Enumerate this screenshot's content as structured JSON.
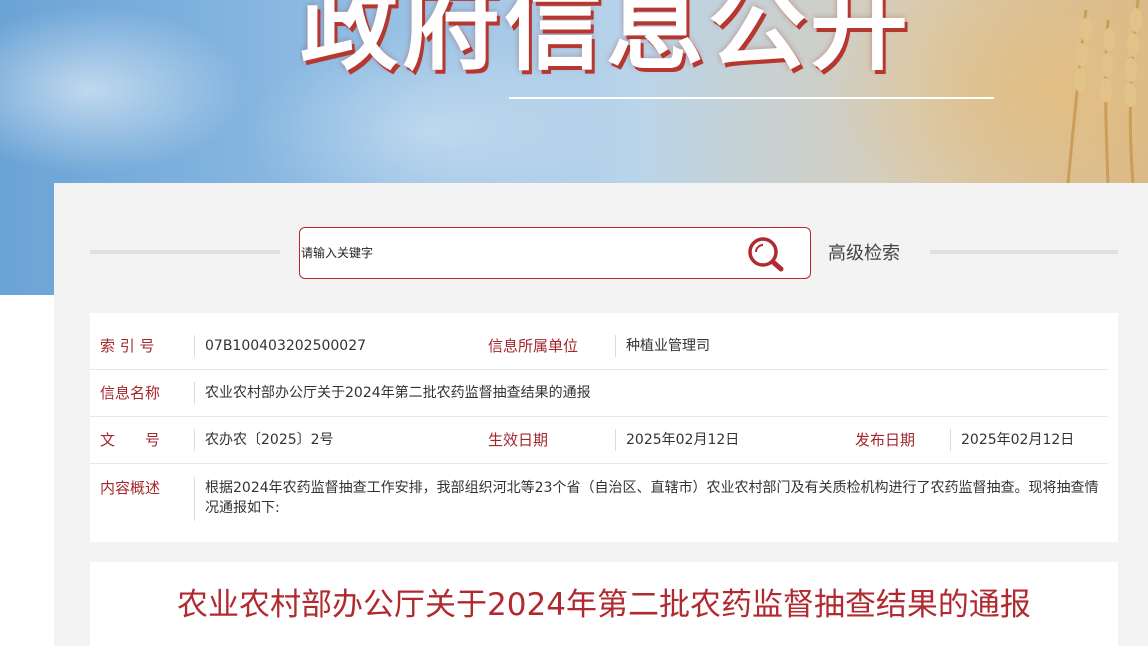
{
  "banner": {
    "title": "政府信息公开"
  },
  "search": {
    "placeholder": "请输入关键字",
    "button_icon": "search-icon",
    "advanced_label": "高级检索"
  },
  "meta": {
    "index_label": "索 引 号",
    "index_value": "07B100403202500027",
    "unit_label": "信息所属单位",
    "unit_value": "种植业管理司",
    "name_label": "信息名称",
    "name_value": "农业农村部办公厅关于2024年第二批农药监督抽查结果的通报",
    "doc_no_label": "文　　号",
    "doc_no_value": "农办农〔2025〕2号",
    "effective_label": "生效日期",
    "effective_value": "2025年02月12日",
    "publish_label": "发布日期",
    "publish_value": "2025年02月12日",
    "summary_label": "内容概述",
    "summary_value": "根据2024年农药监督抽查工作安排，我部组织河北等23个省（自治区、直辖市）农业农村部门及有关质检机构进行了农药监督抽查。现将抽查情况通报如下:"
  },
  "document": {
    "title": "农业农村部办公厅关于2024年第二批农药监督抽查结果的通报"
  },
  "colors": {
    "accent": "#b02a30",
    "label": "#a4262c",
    "panel_bg": "#f3f3f3"
  }
}
